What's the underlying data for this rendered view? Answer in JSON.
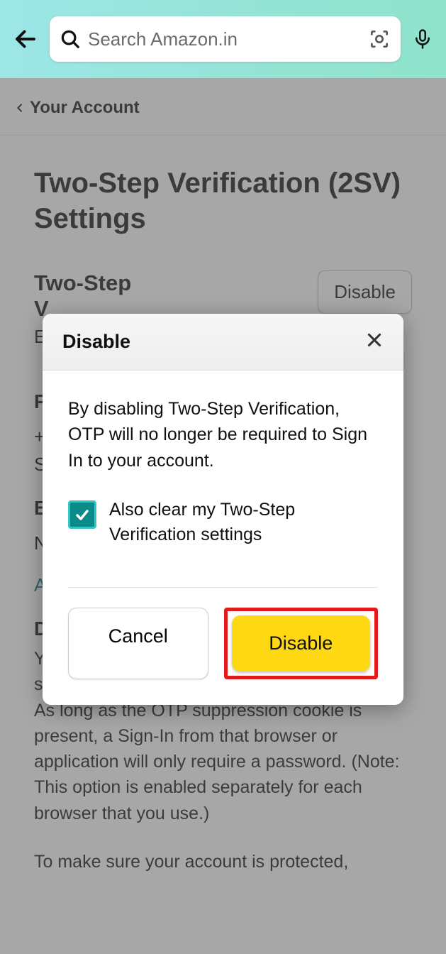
{
  "search": {
    "placeholder": "Search Amazon.in"
  },
  "breadcrumb": {
    "label": "Your Account"
  },
  "page": {
    "title": "Two-Step Verification (2SV) Settings",
    "section_title": "Two-Step",
    "section_title_line2": "V",
    "section_disable_button": "Disable",
    "stub_e": "E",
    "stub_p": "P",
    "stub_plus": "+",
    "stub_s": "S",
    "stub_b": "B",
    "stub_n": "N",
    "stub_a": "A",
    "stub_d": "D",
    "paragraph1": "You may suppress future OTP challenges by selecting \"Don't require OTP on this browser\". As long as the OTP suppression cookie is present, a Sign-In from that browser or application will only require a password. (Note: This option is enabled separately for each browser that you use.)",
    "paragraph2": "To make sure your account is protected,"
  },
  "modal": {
    "title": "Disable",
    "body": "By disabling Two-Step Verification, OTP will no longer be required to Sign In to your account.",
    "checkbox_label": "Also clear my Two-Step Verification settings",
    "cancel": "Cancel",
    "confirm": "Disable"
  }
}
